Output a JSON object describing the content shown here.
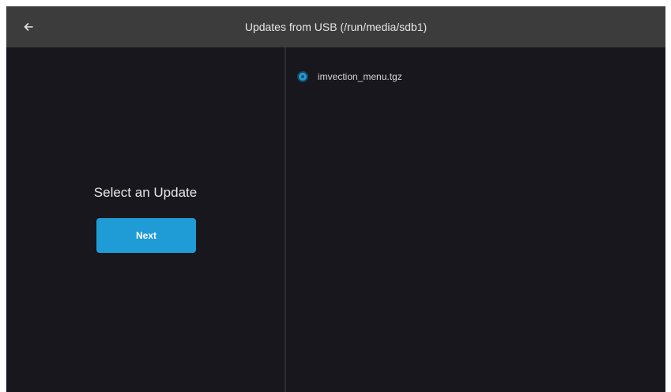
{
  "header": {
    "back_icon": "arrow-left-icon",
    "title": "Updates from USB (/run/media/sdb1)"
  },
  "left_panel": {
    "title": "Select an Update",
    "next_button_label": "Next"
  },
  "file_list": {
    "items": [
      {
        "label": "imvection_menu.tgz",
        "selected": true
      }
    ]
  },
  "colors": {
    "background": "#17171d",
    "header": "#3c3c3c",
    "accent": "#1f9bd6"
  }
}
